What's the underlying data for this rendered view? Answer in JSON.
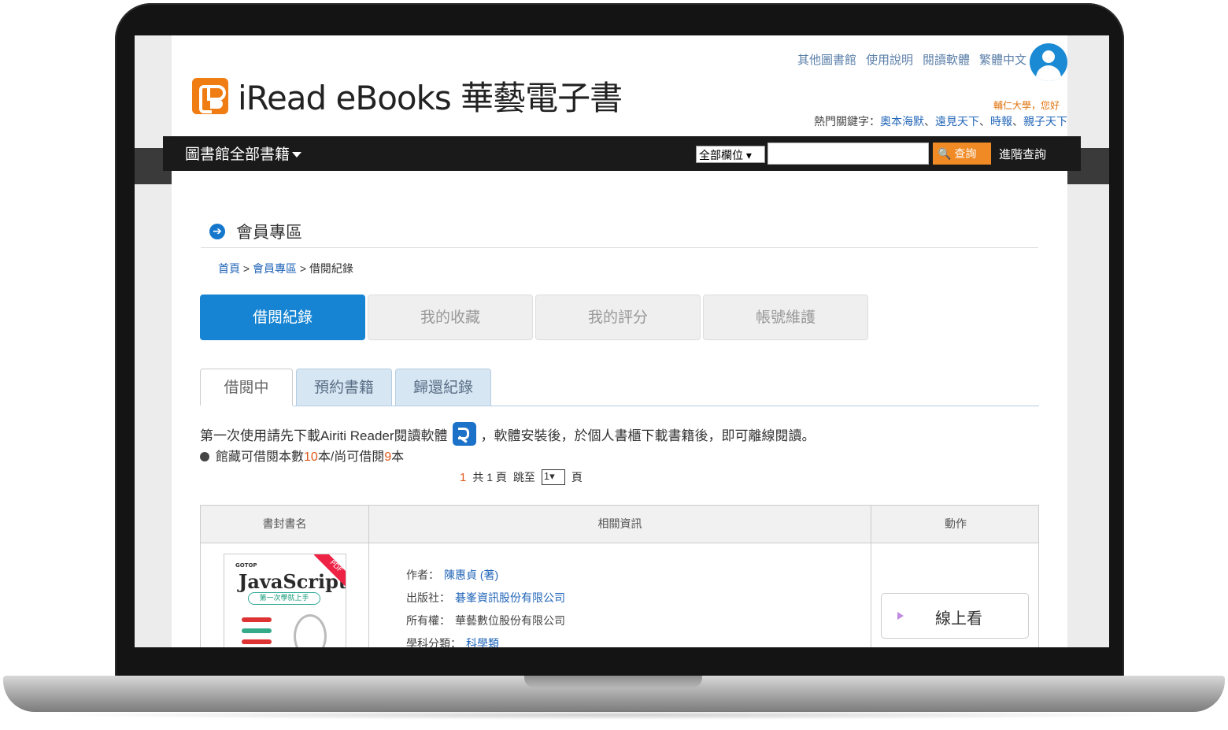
{
  "header": {
    "logo_text": "iRead eBooks 華藝電子書",
    "top_links": [
      "其他圖書館",
      "使用說明",
      "閱讀軟體",
      "繁體中文"
    ],
    "greeting": "輔仁大學，您好",
    "hotwords_label": "熱門關鍵字：",
    "hotwords": [
      "奧本海默",
      "遠見天下",
      "時報",
      "親子天下"
    ]
  },
  "navbar": {
    "title": "圖書館全部書籍",
    "field_select": "全部欄位",
    "search_value": "",
    "search_button": "查詢",
    "advanced": "進階查詢"
  },
  "section": {
    "title": "會員專區",
    "breadcrumb": [
      "首頁",
      "會員專區",
      "借閱紀錄"
    ]
  },
  "main_tabs": [
    "借閱紀錄",
    "我的收藏",
    "我的評分",
    "帳號維護"
  ],
  "sub_tabs": [
    "借閱中",
    "預約書籍",
    "歸還紀錄"
  ],
  "info": {
    "line1_before": "第一次使用請先下載Airiti Reader閱讀軟體",
    "line1_after": "，軟體安裝後，於個人書櫃下載書籍後，即可離線閱讀。",
    "line2_prefix": "館藏可借閱本數",
    "total": "10",
    "line2_mid": "本/尚可借閱",
    "remaining": "9",
    "line2_suffix": "本"
  },
  "pager": {
    "current": "1",
    "total_text": "共 1 頁",
    "jump_label": "跳至",
    "page_value": "1",
    "page_suffix": "頁"
  },
  "table": {
    "headers": [
      "書封書名",
      "相關資訊",
      "動作"
    ],
    "rows": [
      {
        "cover": {
          "publisher": "GOTOP",
          "title": "JavaScript",
          "subtitle": "第一次學就上手",
          "badge": "PDF"
        },
        "author_label": "作者：",
        "author": "陳惠貞 (著)",
        "publisher_label": "出版社：",
        "publisher": "碁峯資訊股份有限公司",
        "owner_label": "所有權：",
        "owner": "華藝數位股份有限公司",
        "subject_label": "學科分類：",
        "subject": "科學類",
        "action": "線上看"
      }
    ]
  }
}
